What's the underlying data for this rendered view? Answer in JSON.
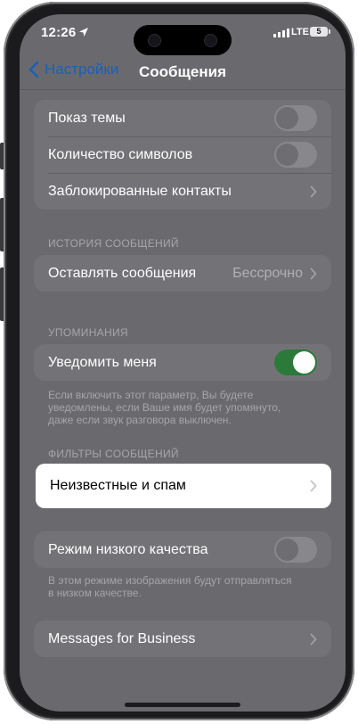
{
  "status_bar": {
    "time": "12:26",
    "network": "LTE",
    "battery": "5"
  },
  "nav": {
    "back_label": "Настройки",
    "title": "Сообщения"
  },
  "top_group": {
    "items": [
      {
        "label": "Показ темы",
        "type": "toggle",
        "on": false
      },
      {
        "label": "Количество символов",
        "type": "toggle",
        "on": false
      },
      {
        "label": "Заблокированные контакты",
        "type": "chevron"
      }
    ]
  },
  "history": {
    "header": "ИСТОРИЯ СООБЩЕНИЙ",
    "keep_label": "Оставлять сообщения",
    "keep_value": "Бессрочно"
  },
  "mentions": {
    "header": "УПОМИНАНИЯ",
    "notify_label": "Уведомить меня",
    "notify_on": true,
    "footer_line1": "Если включить этот параметр, Вы будете",
    "footer_line2": "уведомлены, если Ваше имя будет упомянуто,",
    "footer_line3": "даже если звук разговора выключен."
  },
  "filters": {
    "header": "ФИЛЬТРЫ СООБЩЕНИЙ",
    "unknown_label": "Неизвестные и спам"
  },
  "low_quality": {
    "label": "Режим низкого качества",
    "on": false,
    "footer_line1": "В этом режиме изображения будут отправляться",
    "footer_line2": "в низком качестве."
  },
  "business": {
    "label": "Messages for Business"
  },
  "colors": {
    "accent": "#1a5fb8",
    "toggle_on": "#2c7a3a"
  }
}
